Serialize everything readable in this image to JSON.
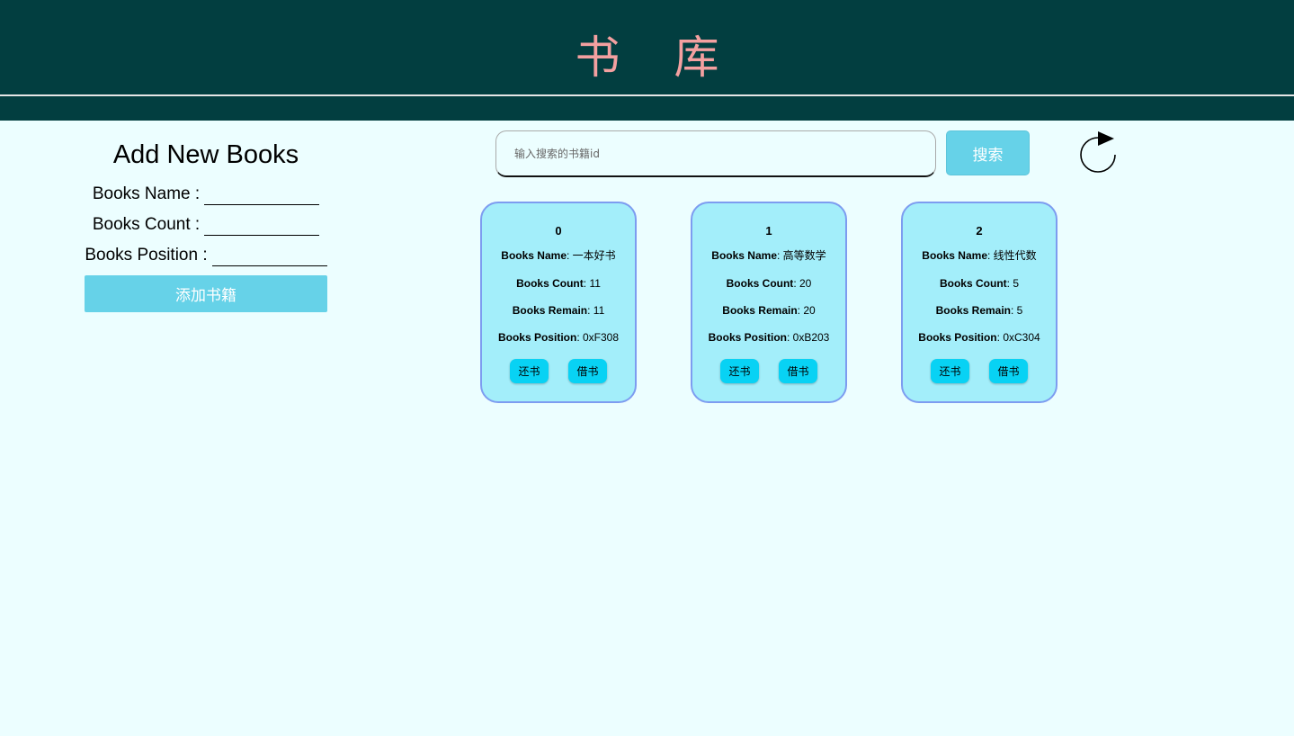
{
  "header": {
    "title": "书库"
  },
  "add_panel": {
    "title": "Add New Books",
    "fields": [
      {
        "label": "Books Name :",
        "value": ""
      },
      {
        "label": "Books Count :",
        "value": ""
      },
      {
        "label": "Books Position :",
        "value": ""
      }
    ],
    "submit_label": "添加书籍"
  },
  "search": {
    "placeholder": "输入搜索的书籍id",
    "value": "",
    "button_label": "搜索"
  },
  "labels": {
    "name": "Books Name",
    "count": "Books Count",
    "remain": "Books Remain",
    "position": "Books Position"
  },
  "books": [
    {
      "id": "0",
      "name": "一本好书",
      "count": "11",
      "remain": "11",
      "position": "0xF308",
      "return_label": "还书",
      "borrow_label": "借书"
    },
    {
      "id": "1",
      "name": "高等数学",
      "count": "20",
      "remain": "20",
      "position": "0xB203",
      "return_label": "还书",
      "borrow_label": "借书"
    },
    {
      "id": "2",
      "name": "线性代数",
      "count": "5",
      "remain": "5",
      "position": "0xC304",
      "return_label": "还书",
      "borrow_label": "借书"
    }
  ],
  "icons": {
    "refresh": "refresh-icon"
  },
  "colors": {
    "header_bg": "#023e40",
    "title": "#f3a0a0",
    "page_bg": "#ecfeff",
    "accent_button": "#66d2e8",
    "card_bg": "#a3eefa",
    "card_border": "#7d9cf0",
    "card_button": "#08d2f4"
  }
}
